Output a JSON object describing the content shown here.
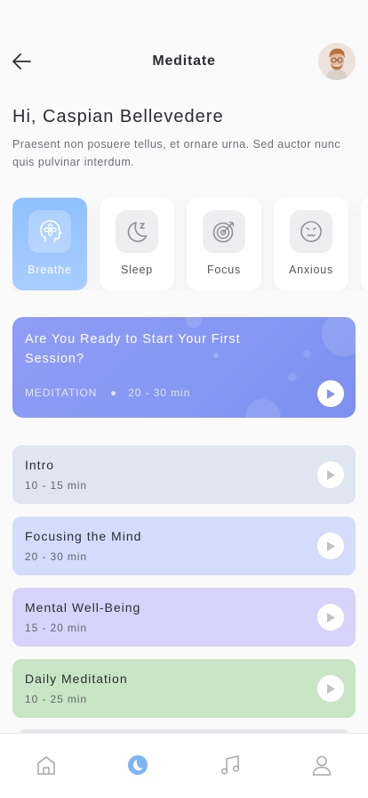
{
  "header": {
    "title": "Meditate",
    "back_icon": "arrow-left-icon",
    "avatar_icon": "user-avatar"
  },
  "greeting": "Hi, Caspian Bellevedere",
  "subtitle": "Praesent non posuere tellus, et ornare urna. Sed auctor nunc quis pulvinar interdum.",
  "categories": [
    {
      "label": "Breathe",
      "icon": "head-flower-icon",
      "active": true
    },
    {
      "label": "Sleep",
      "icon": "moon-icon",
      "active": false
    },
    {
      "label": "Focus",
      "icon": "target-icon",
      "active": false
    },
    {
      "label": "Anxious",
      "icon": "frown-face-icon",
      "active": false
    }
  ],
  "hero": {
    "title": "Are You Ready to Start Your First Session?",
    "tag": "MEDITATION",
    "duration": "20 - 30 min",
    "color": "#8797f3"
  },
  "sessions": [
    {
      "title": "Intro",
      "duration": "10 - 15 min",
      "color": "#dfe5f1"
    },
    {
      "title": "Focusing the Mind",
      "duration": "20 - 30 min",
      "color": "#d3dcfb"
    },
    {
      "title": "Mental Well-Being",
      "duration": "15 - 20 min",
      "color": "#d7d3fa"
    },
    {
      "title": "Daily Meditation",
      "duration": "10 - 25 min",
      "color": "#c8e6c5"
    }
  ],
  "tabbar": [
    {
      "icon": "home-icon",
      "active": false
    },
    {
      "icon": "moon-icon",
      "active": true
    },
    {
      "icon": "music-note-icon",
      "active": false
    },
    {
      "icon": "profile-icon",
      "active": false
    }
  ],
  "colors": {
    "accent": "#8fc0ff",
    "tab_active": "#7fb4f5",
    "tab_inactive": "#a5a6ad"
  }
}
